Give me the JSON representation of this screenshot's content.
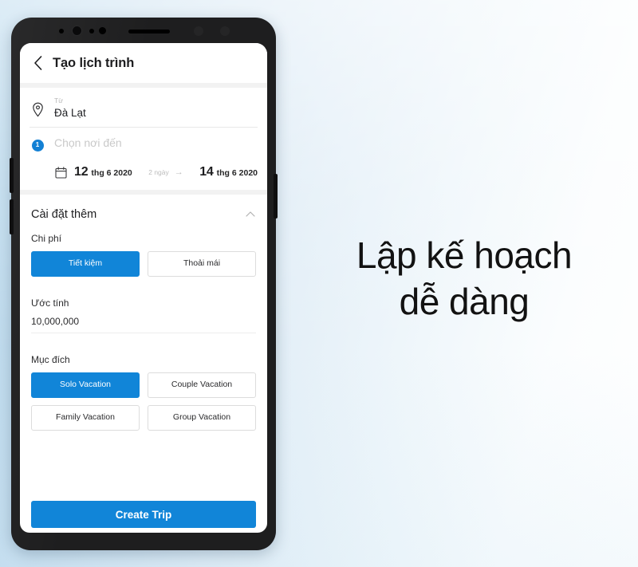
{
  "background": {
    "gradient_from": "#b4d6ec",
    "gradient_to": "#ffffff"
  },
  "headline": {
    "line1": "Lập kế hoạch",
    "line2": "dễ dàng"
  },
  "phone": {
    "hardware": {
      "earpiece": "earpiece-speaker",
      "volume_up": "volume-up-button",
      "volume_down": "volume-down-button",
      "power": "power-button"
    }
  },
  "app": {
    "accent_color": "#1185d8",
    "header": {
      "back_icon": "chevron-left-icon",
      "title": "Tạo lịch trình"
    },
    "origin": {
      "icon": "location-pin-icon",
      "label": "Từ",
      "value": "Đà Lạt"
    },
    "destination": {
      "badge": "1",
      "placeholder": "Chọn nơi đến"
    },
    "dates": {
      "icon": "calendar-icon",
      "start_day": "12",
      "start_rest": "thg 6 2020",
      "duration": "2 ngày",
      "arrow_icon": "arrow-right-icon",
      "end_day": "14",
      "end_rest": "thg 6 2020"
    },
    "settings": {
      "title": "Cài đặt thêm",
      "chevron_icon": "chevron-up-icon",
      "cost": {
        "label": "Chi phí",
        "options": [
          {
            "label": "Tiết kiệm",
            "selected": true
          },
          {
            "label": "Thoải mái",
            "selected": false
          }
        ]
      },
      "estimate": {
        "label": "Ước tính",
        "value": "10,000,000"
      },
      "purpose": {
        "label": "Mục đích",
        "options": [
          {
            "label": "Solo Vacation",
            "selected": true
          },
          {
            "label": "Couple Vacation",
            "selected": false
          },
          {
            "label": "Family Vacation",
            "selected": false
          },
          {
            "label": "Group Vacation",
            "selected": false
          }
        ]
      }
    },
    "cta": {
      "label": "Create Trip"
    }
  }
}
